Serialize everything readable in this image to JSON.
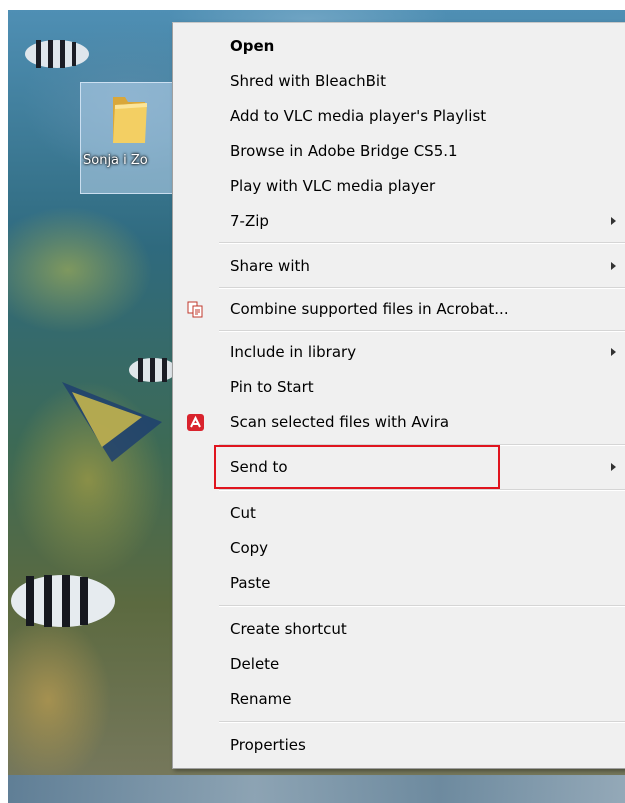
{
  "desktop": {
    "folder_label": "Sonja i Zo"
  },
  "context_menu": {
    "groups": [
      [
        {
          "label": "Open",
          "bold": true
        },
        {
          "label": "Shred with BleachBit"
        },
        {
          "label": "Add to VLC media player's Playlist"
        },
        {
          "label": "Browse in Adobe Bridge CS5.1"
        },
        {
          "label": "Play with VLC media player"
        },
        {
          "label": "7-Zip",
          "submenu": true
        }
      ],
      [
        {
          "label": "Share with",
          "submenu": true
        }
      ],
      [
        {
          "label": "Combine supported files in Acrobat...",
          "icon": "acrobat-combine-icon"
        }
      ],
      [
        {
          "label": "Include in library",
          "submenu": true
        },
        {
          "label": "Pin to Start"
        },
        {
          "label": "Scan selected files with Avira",
          "icon": "avira-icon"
        }
      ],
      [
        {
          "label": "Send to",
          "submenu": true,
          "highlighted": true
        }
      ],
      [
        {
          "label": "Cut"
        },
        {
          "label": "Copy"
        },
        {
          "label": "Paste"
        }
      ],
      [
        {
          "label": "Create shortcut"
        },
        {
          "label": "Delete"
        },
        {
          "label": "Rename"
        }
      ],
      [
        {
          "label": "Properties"
        }
      ]
    ]
  },
  "colors": {
    "menu_background": "#f0f0f0",
    "highlight_box": "#e0141e",
    "avira_red": "#d9232d"
  }
}
